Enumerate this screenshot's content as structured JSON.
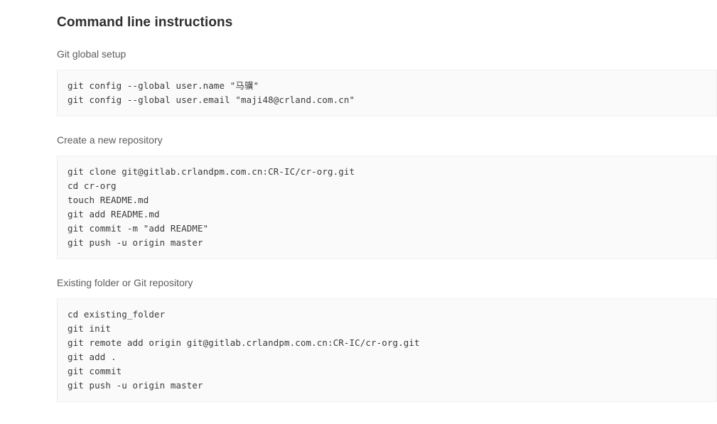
{
  "page": {
    "title": "Command line instructions"
  },
  "sections": [
    {
      "id": "git-global-setup",
      "title": "Git global setup",
      "lines": [
        "git config --global user.name \"马骥\"",
        "git config --global user.email \"maji48@crland.com.cn\""
      ]
    },
    {
      "id": "create-a-new-repository",
      "title": "Create a new repository",
      "lines": [
        "git clone git@gitlab.crlandpm.com.cn:CR-IC/cr-org.git",
        "cd cr-org",
        "touch README.md",
        "git add README.md",
        "git commit -m \"add README\"",
        "git push -u origin master"
      ]
    },
    {
      "id": "existing-folder-or-git-repository",
      "title": "Existing folder or Git repository",
      "lines": [
        "cd existing_folder",
        "git init",
        "git remote add origin git@gitlab.crlandpm.com.cn:CR-IC/cr-org.git",
        "git add .",
        "git commit",
        "git push -u origin master"
      ]
    }
  ],
  "colors": {
    "page_background": "#ffffff",
    "code_background": "#fafafa",
    "code_border": "#f0f0f0",
    "title_text": "#2e2e2e",
    "section_title_text": "#5c5c5c",
    "code_text": "#3a3a3a"
  }
}
